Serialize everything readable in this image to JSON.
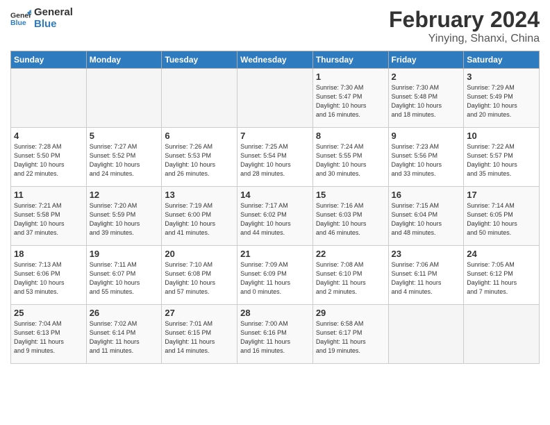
{
  "header": {
    "logo_line1": "General",
    "logo_line2": "Blue",
    "title": "February 2024",
    "subtitle": "Yinying, Shanxi, China"
  },
  "weekdays": [
    "Sunday",
    "Monday",
    "Tuesday",
    "Wednesday",
    "Thursday",
    "Friday",
    "Saturday"
  ],
  "weeks": [
    [
      {
        "day": "",
        "info": ""
      },
      {
        "day": "",
        "info": ""
      },
      {
        "day": "",
        "info": ""
      },
      {
        "day": "",
        "info": ""
      },
      {
        "day": "1",
        "info": "Sunrise: 7:30 AM\nSunset: 5:47 PM\nDaylight: 10 hours\nand 16 minutes."
      },
      {
        "day": "2",
        "info": "Sunrise: 7:30 AM\nSunset: 5:48 PM\nDaylight: 10 hours\nand 18 minutes."
      },
      {
        "day": "3",
        "info": "Sunrise: 7:29 AM\nSunset: 5:49 PM\nDaylight: 10 hours\nand 20 minutes."
      }
    ],
    [
      {
        "day": "4",
        "info": "Sunrise: 7:28 AM\nSunset: 5:50 PM\nDaylight: 10 hours\nand 22 minutes."
      },
      {
        "day": "5",
        "info": "Sunrise: 7:27 AM\nSunset: 5:52 PM\nDaylight: 10 hours\nand 24 minutes."
      },
      {
        "day": "6",
        "info": "Sunrise: 7:26 AM\nSunset: 5:53 PM\nDaylight: 10 hours\nand 26 minutes."
      },
      {
        "day": "7",
        "info": "Sunrise: 7:25 AM\nSunset: 5:54 PM\nDaylight: 10 hours\nand 28 minutes."
      },
      {
        "day": "8",
        "info": "Sunrise: 7:24 AM\nSunset: 5:55 PM\nDaylight: 10 hours\nand 30 minutes."
      },
      {
        "day": "9",
        "info": "Sunrise: 7:23 AM\nSunset: 5:56 PM\nDaylight: 10 hours\nand 33 minutes."
      },
      {
        "day": "10",
        "info": "Sunrise: 7:22 AM\nSunset: 5:57 PM\nDaylight: 10 hours\nand 35 minutes."
      }
    ],
    [
      {
        "day": "11",
        "info": "Sunrise: 7:21 AM\nSunset: 5:58 PM\nDaylight: 10 hours\nand 37 minutes."
      },
      {
        "day": "12",
        "info": "Sunrise: 7:20 AM\nSunset: 5:59 PM\nDaylight: 10 hours\nand 39 minutes."
      },
      {
        "day": "13",
        "info": "Sunrise: 7:19 AM\nSunset: 6:00 PM\nDaylight: 10 hours\nand 41 minutes."
      },
      {
        "day": "14",
        "info": "Sunrise: 7:17 AM\nSunset: 6:02 PM\nDaylight: 10 hours\nand 44 minutes."
      },
      {
        "day": "15",
        "info": "Sunrise: 7:16 AM\nSunset: 6:03 PM\nDaylight: 10 hours\nand 46 minutes."
      },
      {
        "day": "16",
        "info": "Sunrise: 7:15 AM\nSunset: 6:04 PM\nDaylight: 10 hours\nand 48 minutes."
      },
      {
        "day": "17",
        "info": "Sunrise: 7:14 AM\nSunset: 6:05 PM\nDaylight: 10 hours\nand 50 minutes."
      }
    ],
    [
      {
        "day": "18",
        "info": "Sunrise: 7:13 AM\nSunset: 6:06 PM\nDaylight: 10 hours\nand 53 minutes."
      },
      {
        "day": "19",
        "info": "Sunrise: 7:11 AM\nSunset: 6:07 PM\nDaylight: 10 hours\nand 55 minutes."
      },
      {
        "day": "20",
        "info": "Sunrise: 7:10 AM\nSunset: 6:08 PM\nDaylight: 10 hours\nand 57 minutes."
      },
      {
        "day": "21",
        "info": "Sunrise: 7:09 AM\nSunset: 6:09 PM\nDaylight: 11 hours\nand 0 minutes."
      },
      {
        "day": "22",
        "info": "Sunrise: 7:08 AM\nSunset: 6:10 PM\nDaylight: 11 hours\nand 2 minutes."
      },
      {
        "day": "23",
        "info": "Sunrise: 7:06 AM\nSunset: 6:11 PM\nDaylight: 11 hours\nand 4 minutes."
      },
      {
        "day": "24",
        "info": "Sunrise: 7:05 AM\nSunset: 6:12 PM\nDaylight: 11 hours\nand 7 minutes."
      }
    ],
    [
      {
        "day": "25",
        "info": "Sunrise: 7:04 AM\nSunset: 6:13 PM\nDaylight: 11 hours\nand 9 minutes."
      },
      {
        "day": "26",
        "info": "Sunrise: 7:02 AM\nSunset: 6:14 PM\nDaylight: 11 hours\nand 11 minutes."
      },
      {
        "day": "27",
        "info": "Sunrise: 7:01 AM\nSunset: 6:15 PM\nDaylight: 11 hours\nand 14 minutes."
      },
      {
        "day": "28",
        "info": "Sunrise: 7:00 AM\nSunset: 6:16 PM\nDaylight: 11 hours\nand 16 minutes."
      },
      {
        "day": "29",
        "info": "Sunrise: 6:58 AM\nSunset: 6:17 PM\nDaylight: 11 hours\nand 19 minutes."
      },
      {
        "day": "",
        "info": ""
      },
      {
        "day": "",
        "info": ""
      }
    ]
  ]
}
